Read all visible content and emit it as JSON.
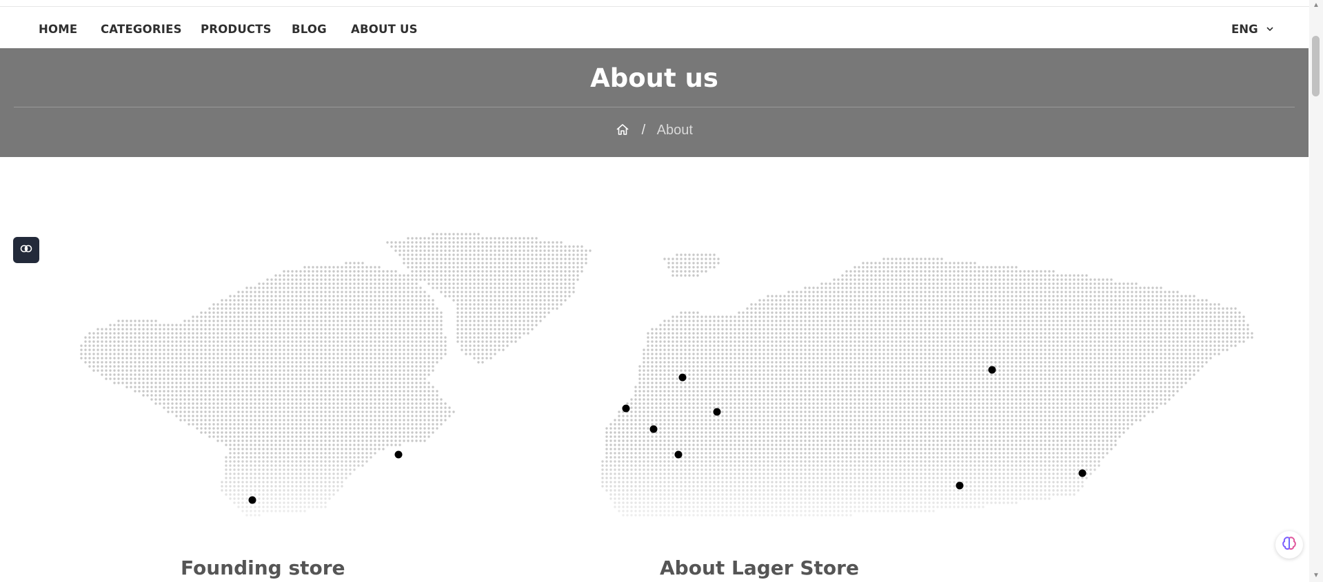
{
  "nav": {
    "items": [
      "HOME",
      "CATEGORIES",
      "PRODUCTS",
      "BLOG",
      "ABOUT US"
    ],
    "language": "ENG"
  },
  "hero": {
    "title": "About us",
    "breadcrumb_current": "About",
    "breadcrumb_separator": "/"
  },
  "sections": {
    "left_title": "Founding store",
    "right_title": "About Lager Store"
  },
  "icons": {
    "home": "home-icon",
    "chevron": "chevron-down-icon",
    "widget": "brain-icon",
    "assistant": "brain-icon"
  },
  "colors": {
    "hero_bg": "#787878",
    "map_dot": "#c8c8c8",
    "marker": "#000000"
  }
}
